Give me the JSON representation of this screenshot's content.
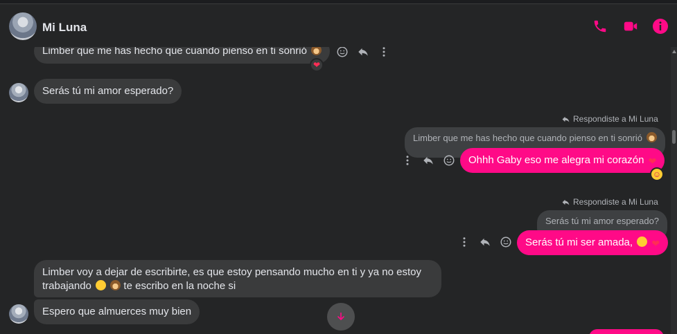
{
  "header": {
    "contact_name": "Mi Luna",
    "icons": [
      "phone-icon",
      "video-camera-icon",
      "info-icon"
    ],
    "accent_color": "#ff0a87"
  },
  "messages": {
    "m1": {
      "text": "Limber que me has hecho que cuando pienso en ti sonrió",
      "reaction": "heart"
    },
    "m2": {
      "text": "Serás tú mi amor esperado?"
    },
    "m3": {
      "replied_label": "Respondiste a Mi Luna",
      "quote": "Limber que me has hecho que cuando pienso en ti sonrió",
      "text": "Ohhh Gaby eso me alegra mi corazón",
      "reaction": "smiling-face-with-hearts"
    },
    "m4": {
      "replied_label": "Respondiste a Mi Luna",
      "quote": "Serás tú mi amor esperado?",
      "text": "Serás tú mi ser amada,"
    },
    "m5": {
      "line1": "Limber voy a dejar de escribirte, es que estoy pensando mucho en ti y ya no estoy",
      "line2": "trabajando",
      "line2_suffix": "te escribo en la noche si"
    },
    "m6": {
      "text": "Espero que almuerces muy bien"
    }
  }
}
